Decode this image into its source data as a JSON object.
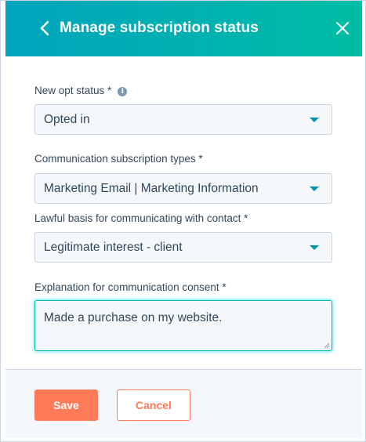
{
  "header": {
    "title": "Manage subscription status",
    "back_icon": "chevron-left-icon",
    "close_icon": "close-icon"
  },
  "form": {
    "opt_status": {
      "label": "New opt status *",
      "info_icon": "info-icon",
      "value": "Opted in"
    },
    "subscription_types": {
      "label": "Communication subscription types *",
      "value": "Marketing Email | Marketing Information"
    },
    "lawful_basis": {
      "label": "Lawful basis for communicating with contact *",
      "value": "Legitimate interest - client"
    },
    "explanation": {
      "label": "Explanation for communication consent *",
      "value": "Made a purchase on my website."
    }
  },
  "footer": {
    "save_label": "Save",
    "cancel_label": "Cancel"
  },
  "colors": {
    "header_gradient_start": "#00a4bd",
    "header_gradient_end": "#00bda5",
    "primary_button": "#ff7a59",
    "dropdown_caret": "#0091ae",
    "text": "#33475b"
  }
}
